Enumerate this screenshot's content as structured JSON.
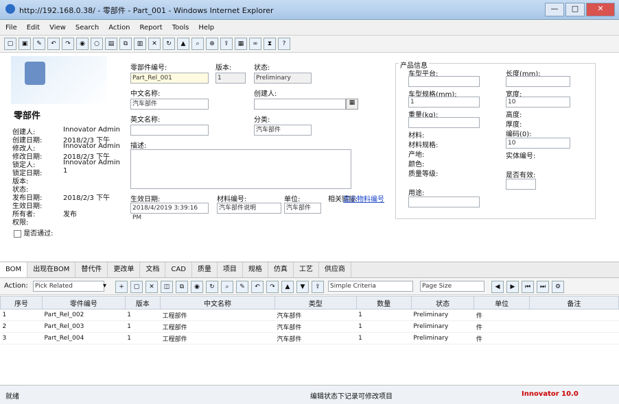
{
  "window": {
    "title": "http://192.168.0.38/ - 零部件 - Part_001 - Windows Internet Explorer",
    "btns": [
      "—",
      "□",
      "✕"
    ]
  },
  "menu": [
    "File",
    "Edit",
    "View",
    "Search",
    "Action",
    "Report",
    "Tools",
    "Help"
  ],
  "form": {
    "header": "零部件",
    "part_no_label": "零部件编号:",
    "part_no_value": "Part_Rel_001",
    "ver_label": "版本:",
    "ver_value": "1",
    "status_label": "状态:",
    "status_value": "Preliminary",
    "cn_name_label": "中文名称:",
    "cn_name_value": "汽车部件",
    "creator_label": "创建人:",
    "en_name_label": "英文名称:",
    "type_label": "分类:",
    "type_value": "汽车部件",
    "desc_label": "描述:",
    "left_labels": [
      "创建人:",
      "创建日期:",
      "修改人:",
      "修改日期:",
      "锁定人:",
      "锁定日期:",
      "版本:",
      "状态:",
      "发布日期:",
      "生效日期:",
      "所有者:",
      "权限:"
    ],
    "left_values": [
      "Innovator Admin",
      "2018/2/3 下午",
      "Innovator Admin",
      "2018/2/3 下午",
      "Innovator Admin",
      "1",
      "2018/2/3 下午",
      "",
      "发布"
    ],
    "effective_label": "生效日期:",
    "effective_value": "2018/4/2019 3:39:16 PM",
    "material_label": "材料编号:",
    "material_value": "汽车部件说明",
    "unit_label": "单位:",
    "unit_value": "汽车部件",
    "link_label": "相关链接:",
    "link_text": "显示物料编号",
    "checkbox_label": "是否通过:"
  },
  "props": {
    "title": "产品信息",
    "left": [
      "车型平台:",
      "车型规格(mm):",
      "重量(kg):",
      "材料:",
      "材料规格:",
      "产地:",
      "颜色:",
      "质量等级:",
      "用途:"
    ],
    "left_values": [
      "",
      "1",
      "",
      "",
      "",
      "",
      "",
      "",
      ""
    ],
    "right": [
      "长度(mm):",
      "宽度:",
      "高度:",
      "厚度:",
      "编码(0):",
      "实体编号:",
      "是否有效:"
    ],
    "right_values": [
      "",
      "10",
      "",
      "",
      "10",
      "",
      ""
    ]
  },
  "tabs": [
    "BOM",
    "出现在BOM",
    "替代件",
    "更改单",
    "文档",
    "CAD",
    "质量",
    "项目",
    "规格",
    "仿真",
    "工艺",
    "供应商"
  ],
  "gridbar": {
    "action_label": "Action:",
    "action_value": "Pick Related",
    "search_mode": "Simple Criteria",
    "page_size": "Page Size"
  },
  "grid": {
    "headers": [
      "序号",
      "零件编号",
      "版本",
      "中文名称",
      "类型",
      "数量",
      "状态",
      "单位",
      "备注"
    ],
    "rows": [
      [
        "1",
        "1",
        "Part_Rel_002",
        "1",
        "工程部件",
        "汽车部件",
        "1",
        "Preliminary",
        "件"
      ],
      [
        "2",
        "2",
        "Part_Rel_003",
        "1",
        "工程部件",
        "汽车部件",
        "1",
        "Preliminary",
        "件"
      ],
      [
        "3",
        "3",
        "Part_Rel_004",
        "1",
        "工程部件",
        "汽车部件",
        "1",
        "Preliminary",
        "件"
      ]
    ]
  },
  "status": {
    "left": "就绪",
    "middle": "编辑状态下记录可修改项目",
    "right": "Innovator 10.0"
  },
  "colors": {
    "link": "#1a44c8",
    "status_right": "#cc0000"
  }
}
